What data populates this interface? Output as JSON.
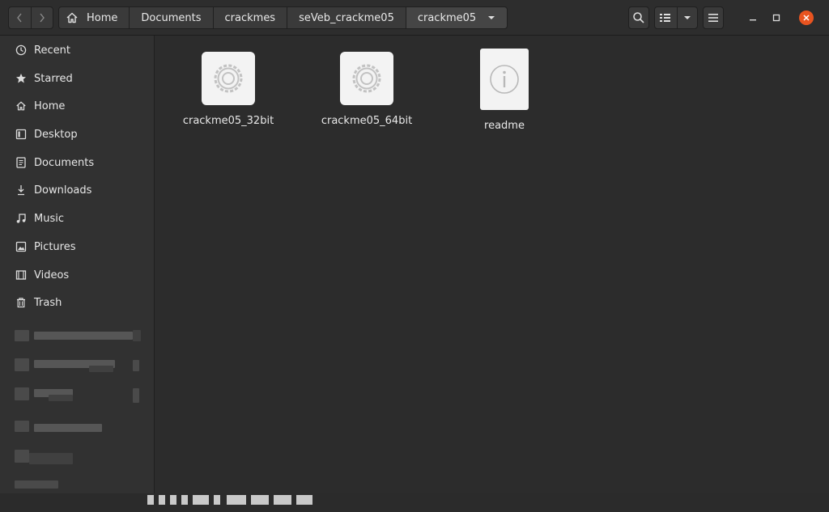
{
  "header": {
    "breadcrumbs": [
      {
        "label": "Home",
        "icon": "home-icon"
      },
      {
        "label": "Documents"
      },
      {
        "label": "crackmes"
      },
      {
        "label": "seVeb_crackme05"
      },
      {
        "label": "crackme05",
        "dropdown": true
      }
    ]
  },
  "sidebar": {
    "items": [
      {
        "label": "Recent",
        "icon": "clock-icon"
      },
      {
        "label": "Starred",
        "icon": "star-icon"
      },
      {
        "label": "Home",
        "icon": "home-icon"
      },
      {
        "label": "Desktop",
        "icon": "desktop-icon"
      },
      {
        "label": "Documents",
        "icon": "document-icon"
      },
      {
        "label": "Downloads",
        "icon": "download-icon"
      },
      {
        "label": "Music",
        "icon": "music-icon"
      },
      {
        "label": "Pictures",
        "icon": "picture-icon"
      },
      {
        "label": "Videos",
        "icon": "video-icon"
      },
      {
        "label": "Trash",
        "icon": "trash-icon"
      }
    ]
  },
  "files": [
    {
      "name": "crackme05_32bit",
      "icon": "executable-gear-icon"
    },
    {
      "name": "crackme05_64bit",
      "icon": "executable-gear-icon"
    },
    {
      "name": "readme",
      "icon": "info-document-icon"
    }
  ],
  "colors": {
    "accent_close": "#e95420",
    "background": "#2c2c2c",
    "sidebar": "#313131"
  }
}
